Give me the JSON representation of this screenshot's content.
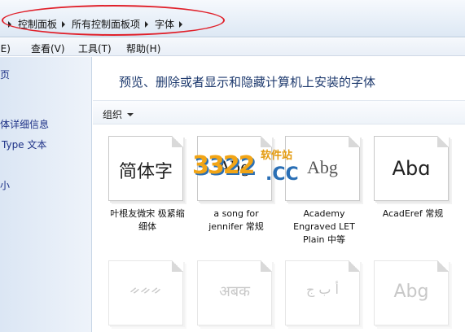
{
  "address": {
    "crumbs": [
      "控制面板",
      "所有控制面板项",
      "字体"
    ]
  },
  "menu": {
    "items": [
      "编辑(E)",
      "查看(V)",
      "工具(T)",
      "帮助(H)"
    ]
  },
  "left_pane": {
    "links": [
      "主页",
      "字体详细信息",
      "TrueType 文本",
      "调整大小"
    ],
    "visible_fragments": [
      "页",
      "体详细信息",
      "Type 文本",
      "小"
    ]
  },
  "main": {
    "heading": "预览、删除或者显示和隐藏计算机上安装的字体",
    "toolbar": {
      "organize_label": "组织"
    }
  },
  "fonts": [
    {
      "sample": "简体字",
      "caption": "叶根友微宋 极紧缩 细体"
    },
    {
      "sample": "Abg",
      "caption": "a song for jennifer 常规"
    },
    {
      "sample": "Abg",
      "caption": "Academy Engraved LET Plain 中等"
    },
    {
      "sample": "Abɑ",
      "caption": "AcadEref 常规"
    },
    {
      "sample": "ᨀᨀᨀ",
      "caption": ""
    },
    {
      "sample": "अबक",
      "caption": ""
    },
    {
      "sample": "أ ب ج",
      "caption": ""
    },
    {
      "sample": "Abg",
      "caption": ""
    }
  ],
  "watermark": {
    "number": "3322",
    "domain": ".CC",
    "tag": "软件站"
  },
  "colors": {
    "annotation": "#e0202a",
    "link": "#1e3287",
    "heading": "#1e3a6e"
  }
}
